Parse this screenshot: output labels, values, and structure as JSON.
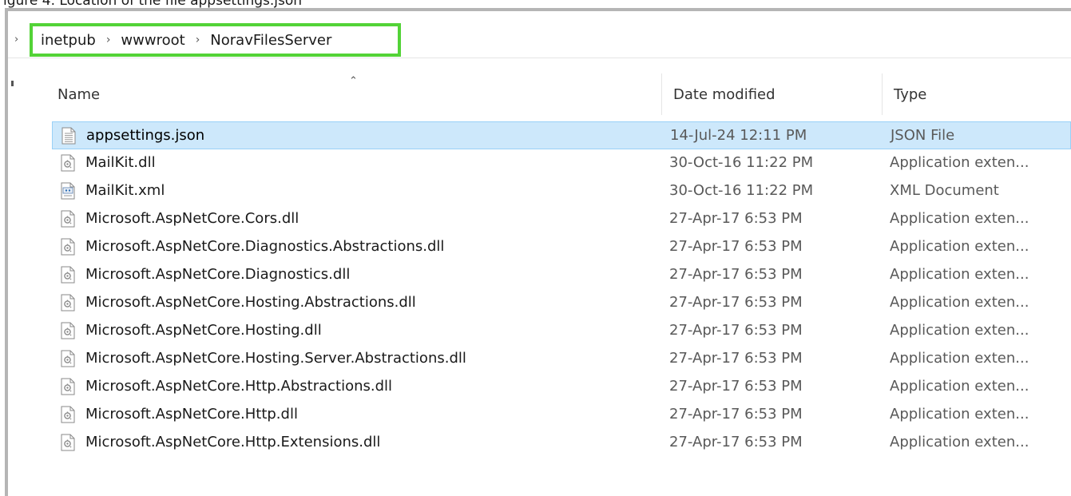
{
  "top_strip_text": "igure 4. Location of the file appsettings.json",
  "address_bar": {
    "crumbs": [
      "inetpub",
      "wwwroot",
      "NoravFilesServer"
    ]
  },
  "columns": {
    "name": "Name",
    "date_modified": "Date modified",
    "type": "Type"
  },
  "files": [
    {
      "name": "appsettings.json",
      "date": "14-Jul-24 12:11 PM",
      "type": "JSON File",
      "icon": "json-file-icon",
      "selected": true
    },
    {
      "name": "MailKit.dll",
      "date": "30-Oct-16 11:22 PM",
      "type": "Application exten...",
      "icon": "dll-file-icon",
      "selected": false
    },
    {
      "name": "MailKit.xml",
      "date": "30-Oct-16 11:22 PM",
      "type": "XML Document",
      "icon": "xml-file-icon",
      "selected": false
    },
    {
      "name": "Microsoft.AspNetCore.Cors.dll",
      "date": "27-Apr-17 6:53 PM",
      "type": "Application exten...",
      "icon": "dll-file-icon",
      "selected": false
    },
    {
      "name": "Microsoft.AspNetCore.Diagnostics.Abstractions.dll",
      "date": "27-Apr-17 6:53 PM",
      "type": "Application exten...",
      "icon": "dll-file-icon",
      "selected": false
    },
    {
      "name": "Microsoft.AspNetCore.Diagnostics.dll",
      "date": "27-Apr-17 6:53 PM",
      "type": "Application exten...",
      "icon": "dll-file-icon",
      "selected": false
    },
    {
      "name": "Microsoft.AspNetCore.Hosting.Abstractions.dll",
      "date": "27-Apr-17 6:53 PM",
      "type": "Application exten...",
      "icon": "dll-file-icon",
      "selected": false
    },
    {
      "name": "Microsoft.AspNetCore.Hosting.dll",
      "date": "27-Apr-17 6:53 PM",
      "type": "Application exten...",
      "icon": "dll-file-icon",
      "selected": false
    },
    {
      "name": "Microsoft.AspNetCore.Hosting.Server.Abstractions.dll",
      "date": "27-Apr-17 6:53 PM",
      "type": "Application exten...",
      "icon": "dll-file-icon",
      "selected": false
    },
    {
      "name": "Microsoft.AspNetCore.Http.Abstractions.dll",
      "date": "27-Apr-17 6:53 PM",
      "type": "Application exten...",
      "icon": "dll-file-icon",
      "selected": false
    },
    {
      "name": "Microsoft.AspNetCore.Http.dll",
      "date": "27-Apr-17 6:53 PM",
      "type": "Application exten...",
      "icon": "dll-file-icon",
      "selected": false
    },
    {
      "name": "Microsoft.AspNetCore.Http.Extensions.dll",
      "date": "27-Apr-17 6:53 PM",
      "type": "Application exten...",
      "icon": "dll-file-icon",
      "selected": false
    }
  ],
  "colors": {
    "highlight_border": "#53d337",
    "selected_row": "#cde8fb",
    "selected_row_border": "#99d1f7",
    "window_frame": "#b5b5b5"
  }
}
